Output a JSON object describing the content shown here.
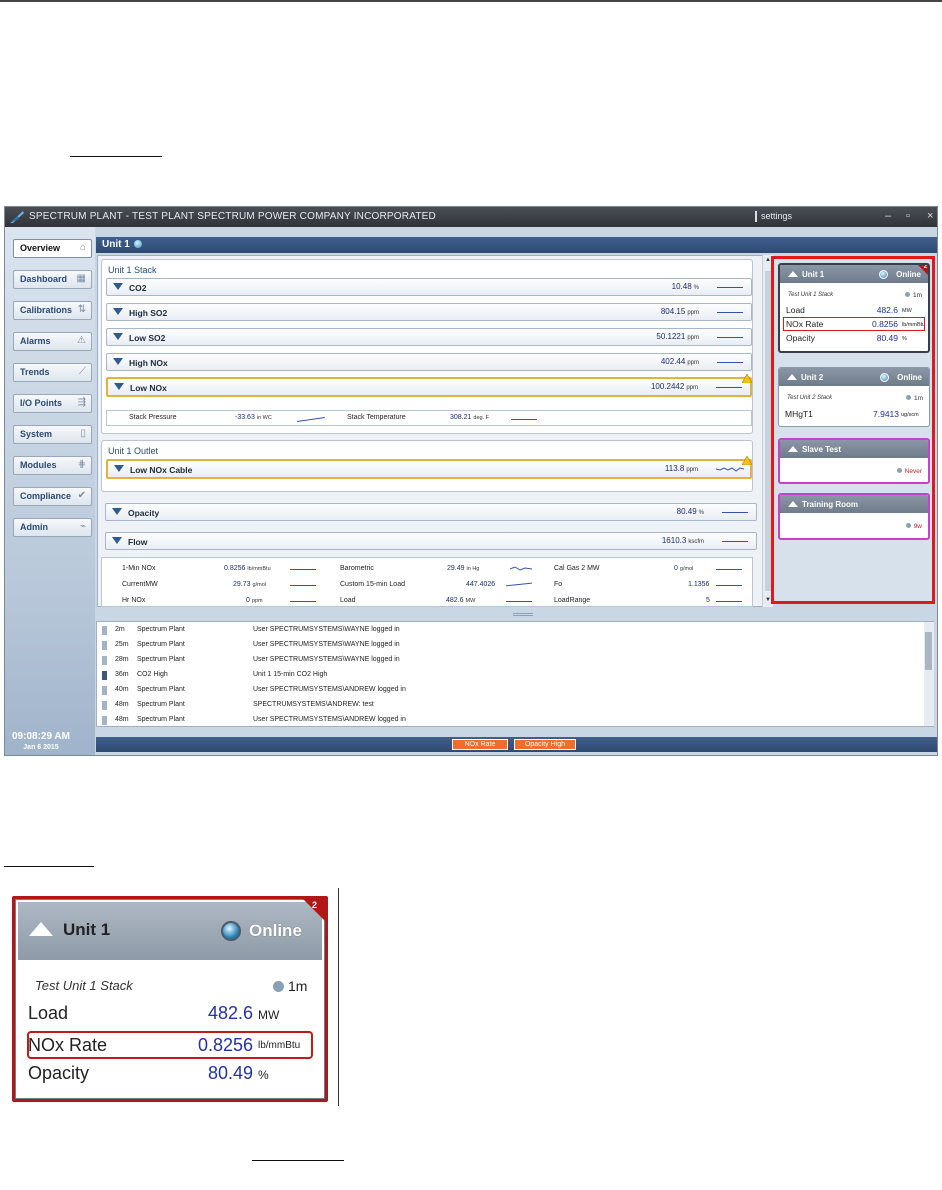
{
  "window": {
    "title": "SPECTRUM PLANT - TEST PLANT SPECTRUM POWER COMPANY INCORPORATED",
    "settings_label": "settings",
    "minimize": "–",
    "maximize": "▫",
    "close": "×"
  },
  "nav": {
    "items": [
      {
        "label": "Overview",
        "icon": "⌂"
      },
      {
        "label": "Dashboard",
        "icon": "▦"
      },
      {
        "label": "Calibrations",
        "icon": "⇅"
      },
      {
        "label": "Alarms",
        "icon": "⚠"
      },
      {
        "label": "Trends",
        "icon": "⟋"
      },
      {
        "label": "I/O Points",
        "icon": "⇶"
      },
      {
        "label": "System",
        "icon": "▯"
      },
      {
        "label": "Modules",
        "icon": "⋕"
      },
      {
        "label": "Compliance",
        "icon": "✔"
      },
      {
        "label": "Admin",
        "icon": "⌁"
      }
    ],
    "clock_time": "09:08:29 AM",
    "clock_date": "Jan 6 2015"
  },
  "unit_header": "Unit 1",
  "stack": {
    "title": "Unit 1 Stack",
    "rows": [
      {
        "label": "CO2",
        "value": "10.48",
        "unit": "%"
      },
      {
        "label": "High SO2",
        "value": "804.15",
        "unit": "ppm"
      },
      {
        "label": "Low SO2",
        "value": "50.1221",
        "unit": "ppm"
      },
      {
        "label": "High NOx",
        "value": "402.44",
        "unit": "ppm"
      },
      {
        "label": "Low NOx",
        "value": "100.2442",
        "unit": "ppm"
      }
    ],
    "pressure_label": "Stack Pressure",
    "pressure_value": "-33.63",
    "pressure_unit": "in WC",
    "temp_label": "Stack Temperature",
    "temp_value": "308.21",
    "temp_unit": "deg. F"
  },
  "outlet": {
    "title": "Unit 1 Outlet",
    "cable_label": "Low NOx Cable",
    "cable_value": "113.8",
    "cable_unit": "ppm"
  },
  "opacity_row": {
    "label": "Opacity",
    "value": "80.49",
    "unit": "%"
  },
  "flow_row": {
    "label": "Flow",
    "value": "1610.3",
    "unit": "kscfm"
  },
  "misc": [
    {
      "label": "1-Min NOx",
      "value": "0.8256",
      "unit": "lb/mmBtu"
    },
    {
      "label": "CurrentMW",
      "value": "29.73",
      "unit": "g/mol"
    },
    {
      "label": "Hr NOx",
      "value": "0",
      "unit": "ppm"
    },
    {
      "label": "Barometric",
      "value": "29.49",
      "unit": "in Hg"
    },
    {
      "label": "Custom 15-min Load",
      "value": "447.4026",
      "unit": ""
    },
    {
      "label": "Load",
      "value": "482.6",
      "unit": "MW"
    },
    {
      "label": "Cal Gas 2 MW",
      "value": "0",
      "unit": "g/mol"
    },
    {
      "label": "Fo",
      "value": "1.1356",
      "unit": ""
    },
    {
      "label": "LoadRange",
      "value": "5",
      "unit": ""
    }
  ],
  "log": [
    {
      "time": "2m",
      "source": "Spectrum Plant",
      "msg": "User SPECTRUMSYSTEMS\\WAYNE logged in"
    },
    {
      "time": "25m",
      "source": "Spectrum Plant",
      "msg": "User SPECTRUMSYSTEMS\\WAYNE logged in"
    },
    {
      "time": "28m",
      "source": "Spectrum Plant",
      "msg": "User SPECTRUMSYSTEMS\\WAYNE logged in"
    },
    {
      "time": "36m",
      "source": "CO2 High",
      "msg": "Unit 1 15-min CO2 High"
    },
    {
      "time": "40m",
      "source": "Spectrum Plant",
      "msg": "User SPECTRUMSYSTEMS\\ANDREW logged in"
    },
    {
      "time": "48m",
      "source": "Spectrum Plant",
      "msg": "SPECTRUMSYSTEMS\\ANDREW: test"
    },
    {
      "time": "48m",
      "source": "Spectrum Plant",
      "msg": "User SPECTRUMSYSTEMS\\ANDREW logged in"
    }
  ],
  "bottom_alarms": {
    "nox": "NOx Rate",
    "opacity": "Opacity High"
  },
  "cards": {
    "unit1": {
      "name": "Unit 1",
      "status": "Online",
      "badge": "2",
      "sub": "Test Unit 1 Stack",
      "age": "1m",
      "rows": [
        {
          "label": "Load",
          "value": "482.6",
          "unit": "MW"
        },
        {
          "label": "NOx Rate",
          "value": "0.8256",
          "unit": "lb/mmBtu"
        },
        {
          "label": "Opacity",
          "value": "80.49",
          "unit": "%"
        }
      ]
    },
    "unit2": {
      "name": "Unit 2",
      "status": "Online",
      "sub": "Test Unit 2 Stack",
      "age": "1m",
      "rows": [
        {
          "label": "MHgT1",
          "value": "7.9413",
          "unit": "ug/scm"
        }
      ]
    },
    "slave": {
      "name": "Slave Test",
      "age": "Never"
    },
    "training": {
      "name": "Training Room",
      "age": "9w"
    }
  }
}
